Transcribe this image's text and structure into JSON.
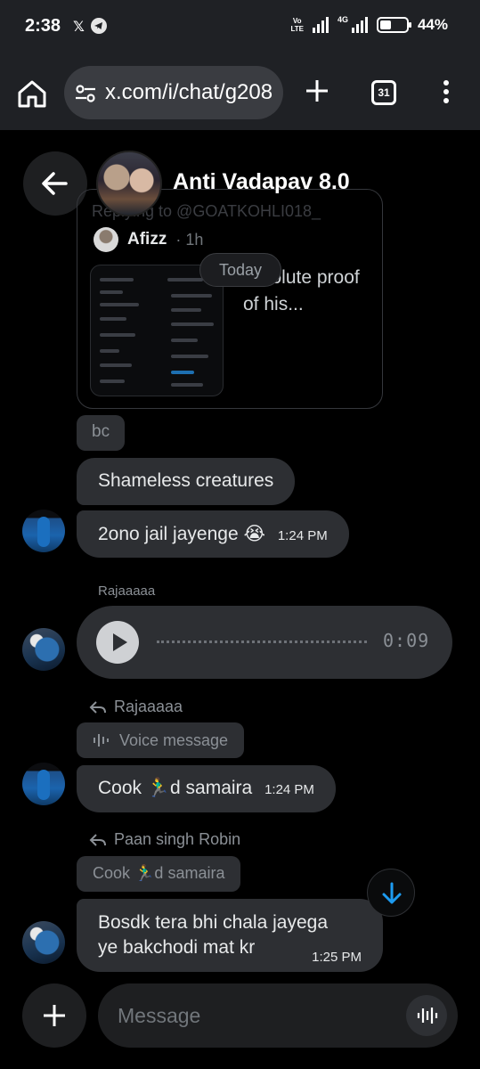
{
  "status_bar": {
    "time": "2:38",
    "notification_icons": [
      "x-logo-icon",
      "telegram-icon"
    ],
    "volte_line1": "Vo",
    "volte_line2": "LTE",
    "network_type": "4G",
    "battery_percent": "44%",
    "battery_level": 0.44
  },
  "browser": {
    "url": "x.com/i/chat/g208",
    "tab_count": "31"
  },
  "chat": {
    "title": "Anti Vadapav 8.0",
    "date_divider": "Today"
  },
  "tweet_card": {
    "replying_to": "Replying to @GOATKOHLI018_",
    "author": "Afizz",
    "age": "· 1h",
    "text": "…solute proof of his..."
  },
  "messages": [
    {
      "text": "bc"
    },
    {
      "text": "Shameless creatures"
    },
    {
      "text": "2ono jail jayenge 😭",
      "time": "1:24 PM"
    },
    {
      "sender": "Rajaaaaa",
      "type": "voice",
      "duration": "0:09"
    },
    {
      "reply_to": "Rajaaaaa",
      "quoted": "Voice message",
      "text": "Cook 🏃‍♂️d samaira",
      "time": "1:24 PM"
    },
    {
      "reply_to": "Paan singh Robin",
      "quoted": "Cook 🏃‍♂️d samaira",
      "text_line1": "Bosdk tera bhi chala jayega",
      "text_line2": "ye bakchodi mat kr",
      "time": "1:25 PM"
    }
  ],
  "composer": {
    "placeholder": "Message"
  },
  "colors": {
    "background": "#000000",
    "bubble": "#2d2f33",
    "accent": "#1d9bf0"
  }
}
